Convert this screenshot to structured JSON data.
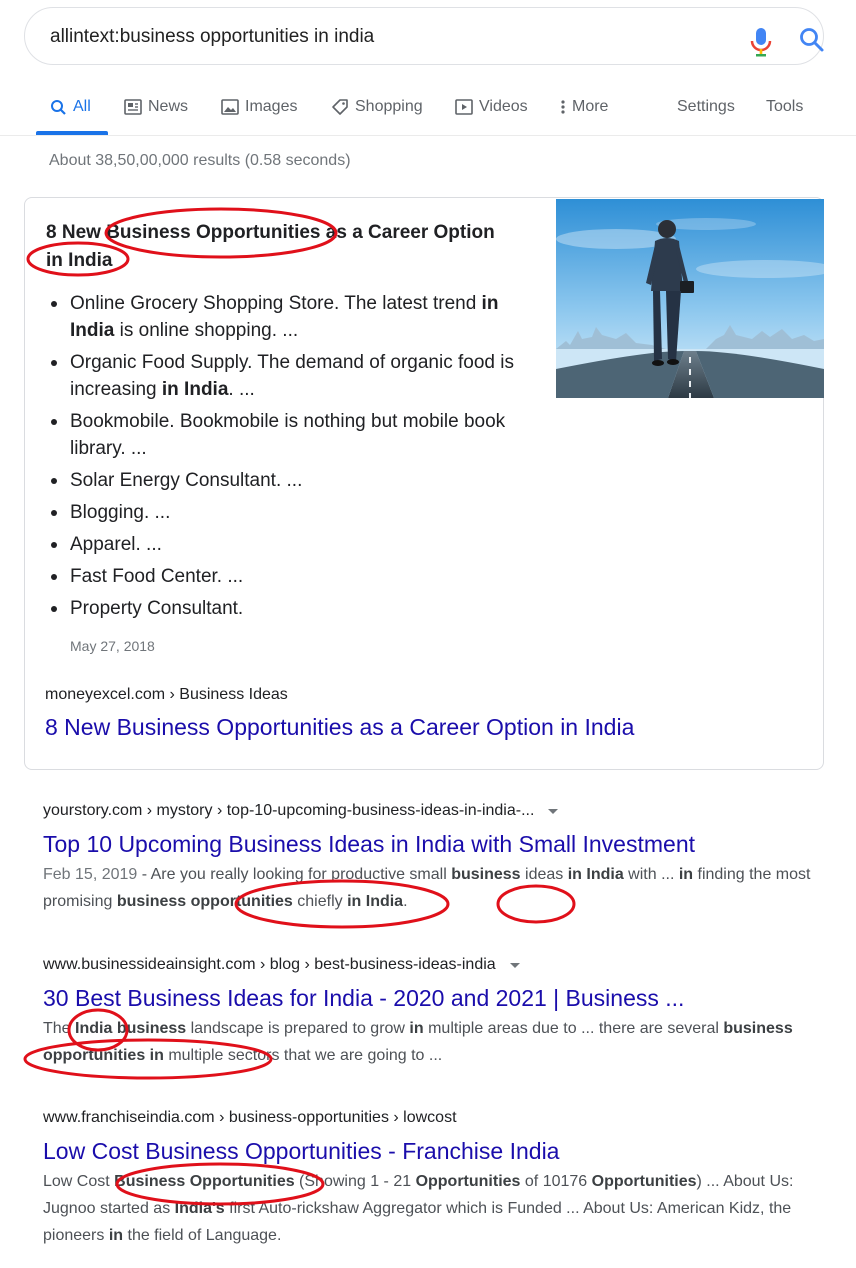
{
  "search": {
    "query": "allintext:business opportunities in india"
  },
  "tabs": {
    "all": "All",
    "news": "News",
    "images": "Images",
    "shopping": "Shopping",
    "videos": "Videos",
    "more": "More",
    "settings": "Settings",
    "tools": "Tools"
  },
  "stats": "About 38,50,00,000 results (0.58 seconds)",
  "featured": {
    "title_1": "8 New Business Opportunities as a Career Option",
    "title_2": "in India",
    "items": [
      {
        "pre": "Online Grocery Shopping Store. The latest trend ",
        "b1": "in India",
        "post": " is online shopping. ..."
      },
      {
        "pre": "Organic Food Supply. The demand of organic food is increasing ",
        "b1": "in India",
        "post": ". ..."
      },
      {
        "pre": "Bookmobile. Bookmobile is nothing but mobile book library. ...",
        "b1": "",
        "post": ""
      },
      {
        "pre": "Solar Energy Consultant. ...",
        "b1": "",
        "post": ""
      },
      {
        "pre": "Blogging. ...",
        "b1": "",
        "post": ""
      },
      {
        "pre": "Apparel. ...",
        "b1": "",
        "post": ""
      },
      {
        "pre": "Fast Food Center. ...",
        "b1": "",
        "post": ""
      },
      {
        "pre": "Property Consultant.",
        "b1": "",
        "post": ""
      }
    ],
    "date": "May 27, 2018",
    "cite": "moneyexcel.com › Business Ideas",
    "link": "8 New Business Opportunities as a Career Option in India"
  },
  "results": [
    {
      "cite": "yourstory.com › mystory › top-10-upcoming-business-ideas-in-india-...",
      "title": "Top 10 Upcoming Business Ideas in India with Small Investment",
      "date": "Feb 15, 2019",
      "s1": " - Are you really looking for productive small ",
      "b1": "business",
      "s2": " ideas ",
      "b2": "in India",
      "s3": " with ... ",
      "b3": "in",
      "s4": " finding the most promising ",
      "b4": "business opportunities",
      "s5": " chiefly ",
      "b5": "in India",
      "s6": "."
    },
    {
      "cite": "www.businessideainsight.com › blog › best-business-ideas-india",
      "title": "30 Best Business Ideas for India - 2020 and 2021 | Business ...",
      "s1": "The ",
      "b1": "India",
      "s2": " ",
      "b2": "business",
      "s3": " landscape is prepared to grow ",
      "b3": "in",
      "s4": " multiple areas due to ... there are several ",
      "b4": "business opportunities in",
      "s5": " multiple sectors that we are going to ..."
    },
    {
      "cite": "www.franchiseindia.com › business-opportunities › lowcost",
      "title": "Low Cost Business Opportunities - Franchise India",
      "s1": "Low Cost ",
      "b1": "Business Opportunities",
      "s2": " (Showing 1 - 21 ",
      "b2": "Opportunities",
      "s3": " of 10176 ",
      "b3": "Opportunities",
      "s4": ") ... About Us: Jugnoo started as ",
      "b4": "India's",
      "s5": " first Auto-rickshaw Aggregator which is Funded ... About Us: American Kidz, the pioneers ",
      "b5": "in",
      "s6": " the field of Language."
    }
  ],
  "colors": {
    "link": "#1a0dab",
    "accent": "#1a73e8",
    "annotation": "#e0101a"
  }
}
